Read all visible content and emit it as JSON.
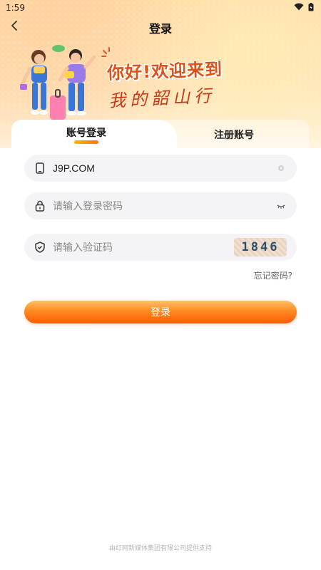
{
  "status_bar": {
    "time": "1:59"
  },
  "header": {
    "title": "登录"
  },
  "hero": {
    "welcome": "你好!欢迎来到",
    "slogan": "我的韶山行"
  },
  "tabs": {
    "login": "账号登录",
    "register": "注册账号"
  },
  "form": {
    "account_value": "J9P.COM",
    "password_placeholder": "请输入登录密码",
    "captcha_placeholder": "请输入验证码",
    "captcha_text": "1846",
    "forgot_label": "忘记密码?",
    "login_label": "登录"
  },
  "footer": {
    "text": "由红网新媒体集团有限公司提供支持"
  },
  "colors": {
    "accent": "#ff7a00",
    "brand_text": "#d9531a"
  }
}
